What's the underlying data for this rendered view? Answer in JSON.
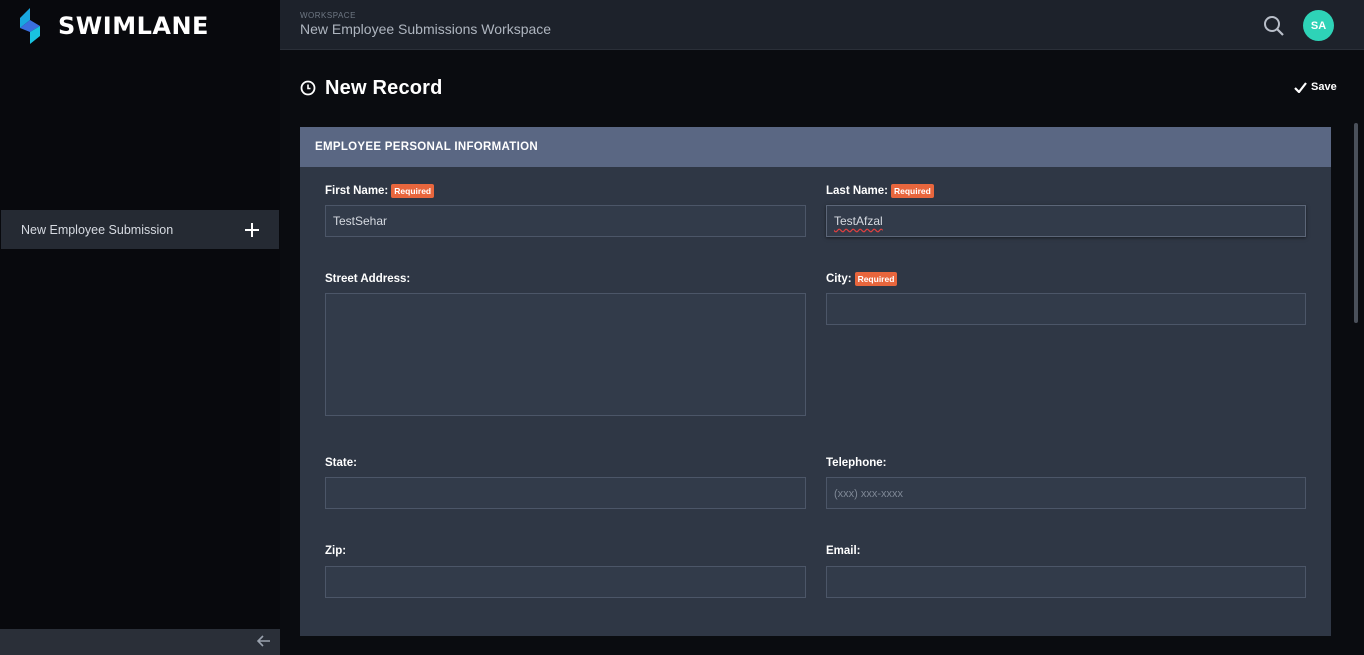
{
  "app": {
    "name": "SWIMLANE"
  },
  "header": {
    "workspace_label": "WORKSPACE",
    "workspace_title": "New Employee Submissions Workspace",
    "avatar_initials": "SA",
    "avatar_color": "#2ed3b7"
  },
  "sidebar": {
    "items": [
      {
        "label": "New Employee Submission"
      }
    ]
  },
  "page": {
    "title": "New Record",
    "save_label": "Save"
  },
  "section": {
    "title": "EMPLOYEE PERSONAL INFORMATION",
    "required_badge": "Required",
    "fields": {
      "first_name": {
        "label": "First Name:",
        "value": "TestSehar"
      },
      "last_name": {
        "label": "Last Name:",
        "value": "TestAfzal"
      },
      "street_address": {
        "label": "Street Address:",
        "value": ""
      },
      "city": {
        "label": "City:",
        "value": ""
      },
      "state": {
        "label": "State:",
        "value": ""
      },
      "telephone": {
        "label": "Telephone:",
        "value": "",
        "placeholder": "(xxx) xxx-xxxx"
      },
      "zip": {
        "label": "Zip:",
        "value": ""
      },
      "email": {
        "label": "Email:",
        "value": ""
      }
    }
  },
  "colors": {
    "accent": "#2ed3b7",
    "required_badge": "#e8663d",
    "section_header": "#5a6783",
    "panel_bg": "#2f3745"
  }
}
